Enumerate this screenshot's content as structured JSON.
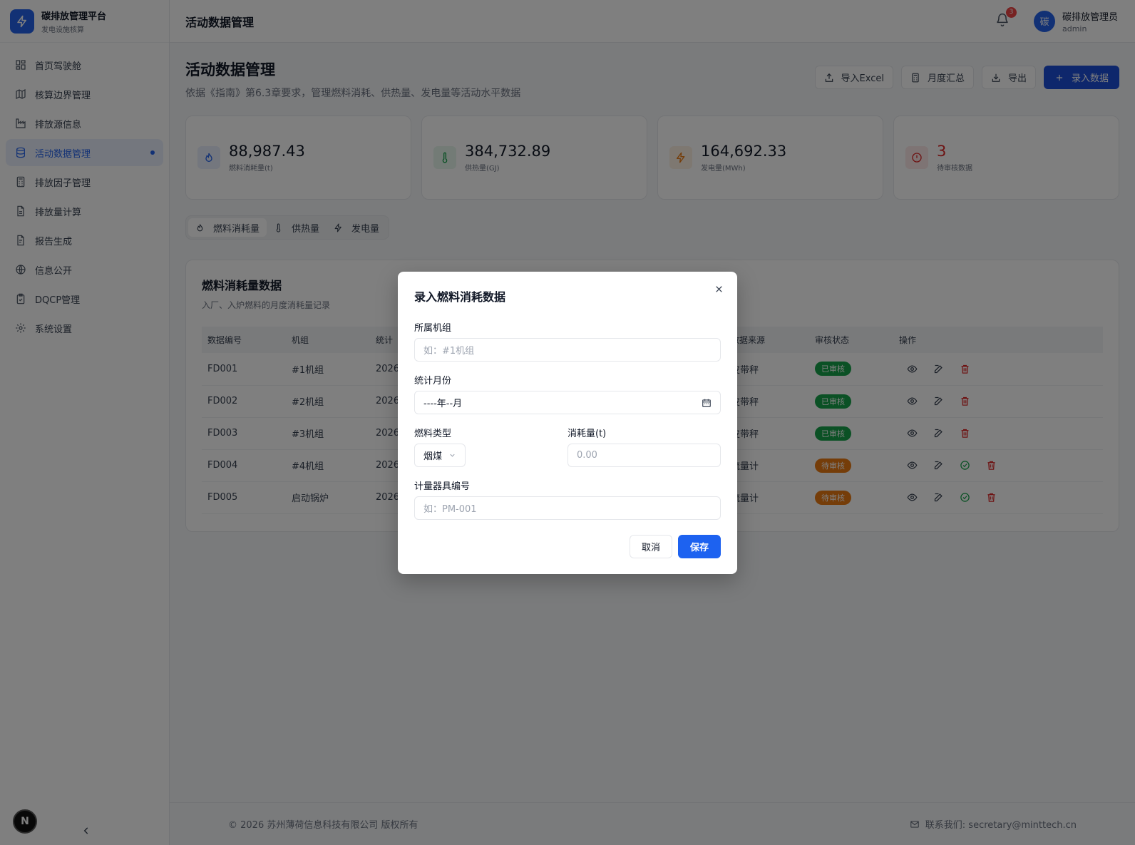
{
  "brand": {
    "title": "碳排放管理平台",
    "subtitle": "发电设施核算"
  },
  "sidebar": {
    "items": [
      {
        "label": "首页驾驶舱",
        "icon": "dashboard-icon"
      },
      {
        "label": "核算边界管理",
        "icon": "map-icon"
      },
      {
        "label": "排放源信息",
        "icon": "factory-icon"
      },
      {
        "label": "活动数据管理",
        "icon": "database-icon",
        "active": true
      },
      {
        "label": "排放因子管理",
        "icon": "calculator-icon"
      },
      {
        "label": "排放量计算",
        "icon": "document-icon"
      },
      {
        "label": "报告生成",
        "icon": "report-icon"
      },
      {
        "label": "信息公开",
        "icon": "globe-icon"
      },
      {
        "label": "DQCP管理",
        "icon": "clipboard-check-icon"
      },
      {
        "label": "系统设置",
        "icon": "gear-icon"
      }
    ],
    "badge_letter": "N"
  },
  "topbar": {
    "title": "活动数据管理",
    "notifications": "3",
    "avatar_char": "碳",
    "user_name": "碳排放管理员",
    "user_role": "admin"
  },
  "page": {
    "title": "活动数据管理",
    "subtitle": "依据《指南》第6.3章要求，管理燃料消耗、供热量、发电量等活动水平数据",
    "actions": {
      "import": "导入Excel",
      "monthly": "月度汇总",
      "export": "导出",
      "add": "录入数据"
    }
  },
  "stats": [
    {
      "value": "88,987.43",
      "label": "燃料消耗量(t)",
      "color": "#2563eb",
      "bg": "#e8effd",
      "value_color": "#111827"
    },
    {
      "value": "384,732.89",
      "label": "供热量(GJ)",
      "color": "#16a34a",
      "bg": "#e7f6ec",
      "value_color": "#111827"
    },
    {
      "value": "164,692.33",
      "label": "发电量(MWh)",
      "color": "#ea7a12",
      "bg": "#fdf0e3",
      "value_color": "#111827"
    },
    {
      "value": "3",
      "label": "待审核数据",
      "color": "#dc2626",
      "bg": "#fde8e8",
      "value_color": "#dc2626"
    }
  ],
  "tabs": [
    {
      "label": "燃料消耗量",
      "active": true
    },
    {
      "label": "供热量"
    },
    {
      "label": "发电量"
    }
  ],
  "card": {
    "title": "燃料消耗量数据",
    "subtitle": "入厂、入炉燃料的月度消耗量记录",
    "columns": [
      "数据编号",
      "机组",
      "统计",
      "",
      "",
      "",
      "数据来源",
      "审核状态",
      "操作"
    ],
    "rows": [
      {
        "id": "FD001",
        "unit": "#1机组",
        "stat": "2026",
        "source": "皮带秤",
        "status": "已审核",
        "status_type": "ok"
      },
      {
        "id": "FD002",
        "unit": "#2机组",
        "stat": "2026",
        "source": "皮带秤",
        "status": "已审核",
        "status_type": "ok"
      },
      {
        "id": "FD003",
        "unit": "#3机组",
        "stat": "2026",
        "source": "皮带秤",
        "status": "已审核",
        "status_type": "ok"
      },
      {
        "id": "FD004",
        "unit": "#4机组",
        "stat": "2026",
        "source": "流量计",
        "status": "待审核",
        "status_type": "pending"
      },
      {
        "id": "FD005",
        "unit": "启动锅炉",
        "stat": "2026",
        "source": "流量计",
        "status": "待审核",
        "status_type": "pending"
      }
    ]
  },
  "footer": {
    "copyright": "© 2026 苏州薄荷信息科技有限公司 版权所有",
    "contact": "联系我们: secretary@minttech.cn"
  },
  "modal": {
    "title": "录入燃料消耗数据",
    "unit_label": "所属机组",
    "unit_placeholder": "如：#1机组",
    "month_label": "统计月份",
    "month_value": "----年--月",
    "fuel_label": "燃料类型",
    "fuel_value": "烟煤",
    "amount_label": "消耗量(t)",
    "amount_placeholder": "0.00",
    "meter_label": "计量器具编号",
    "meter_placeholder": "如：PM-001",
    "cancel": "取消",
    "save": "保存"
  }
}
